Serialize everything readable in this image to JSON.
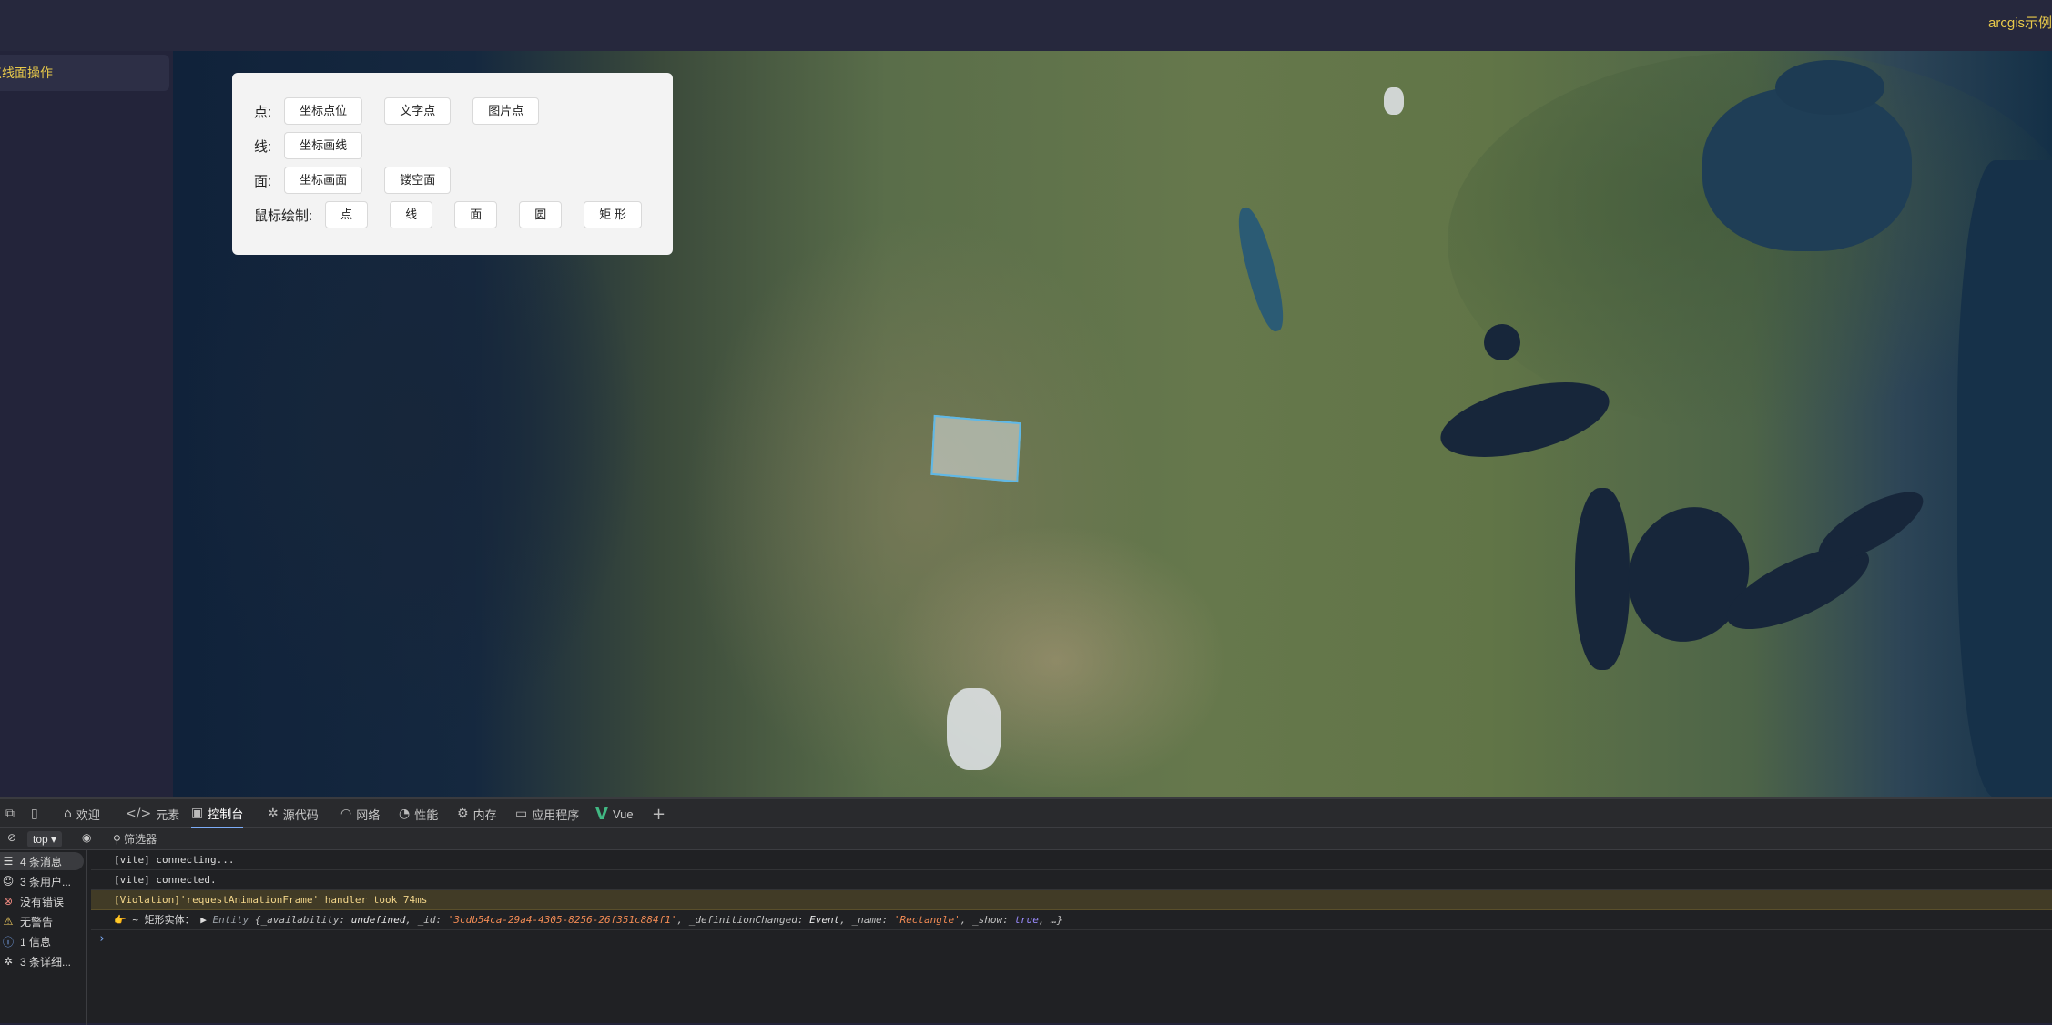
{
  "header": {
    "brand": "arcgis示例"
  },
  "sidebar": {
    "items": [
      {
        "label": "点线面操作"
      }
    ]
  },
  "panel": {
    "point": {
      "label": "点:",
      "buttons": [
        "坐标点位",
        "文字点",
        "图片点"
      ]
    },
    "line": {
      "label": "线:",
      "buttons": [
        "坐标画线"
      ]
    },
    "polygon": {
      "label": "面:",
      "buttons": [
        "坐标画面",
        "镂空面"
      ]
    },
    "mouse_draw": {
      "label": "鼠标绘制:",
      "buttons": [
        "点",
        "线",
        "面",
        "圆",
        "矩 形"
      ]
    }
  },
  "devtools": {
    "tabs": [
      {
        "label": "欢迎",
        "icon": "home-icon"
      },
      {
        "label": "元素",
        "icon": "code-icon"
      },
      {
        "label": "控制台",
        "icon": "console-icon",
        "active": true
      },
      {
        "label": "源代码",
        "icon": "bug-icon"
      },
      {
        "label": "网络",
        "icon": "wifi-icon"
      },
      {
        "label": "性能",
        "icon": "gauge-icon"
      },
      {
        "label": "内存",
        "icon": "gear-icon"
      },
      {
        "label": "应用程序",
        "icon": "app-icon"
      },
      {
        "label": "Vue",
        "icon": "vue-icon"
      }
    ],
    "toolbar": {
      "context": "top",
      "filter_label": "筛选器"
    },
    "side_filters": [
      {
        "label": "4 条消息",
        "icon": "list-icon"
      },
      {
        "label": "3 条用户...",
        "icon": "user-icon"
      },
      {
        "label": "没有错误",
        "icon": "error-icon"
      },
      {
        "label": "无警告",
        "icon": "warning-icon"
      },
      {
        "label": "1 信息",
        "icon": "info-icon"
      },
      {
        "label": "3 条详细...",
        "icon": "bug-icon"
      }
    ],
    "console": {
      "line1": "[vite] connecting...",
      "line2": "[vite] connected.",
      "line3": "[Violation]'requestAnimationFrame' handler took 74ms",
      "line4": {
        "prefix": "👉 ~ 矩形实体：",
        "entity": "Entity",
        "k1": "{_availability:",
        "v1": "undefined",
        "k2": ", _id:",
        "v2": "'3cdb54ca-29a4-4305-8256-26f351c884f1'",
        "k3": ", _definitionChanged:",
        "v3": "Event",
        "k4": ", _name:",
        "v4": "'Rectangle'",
        "k5": ", _show:",
        "v5": "true",
        "k6": ", …}"
      }
    }
  }
}
